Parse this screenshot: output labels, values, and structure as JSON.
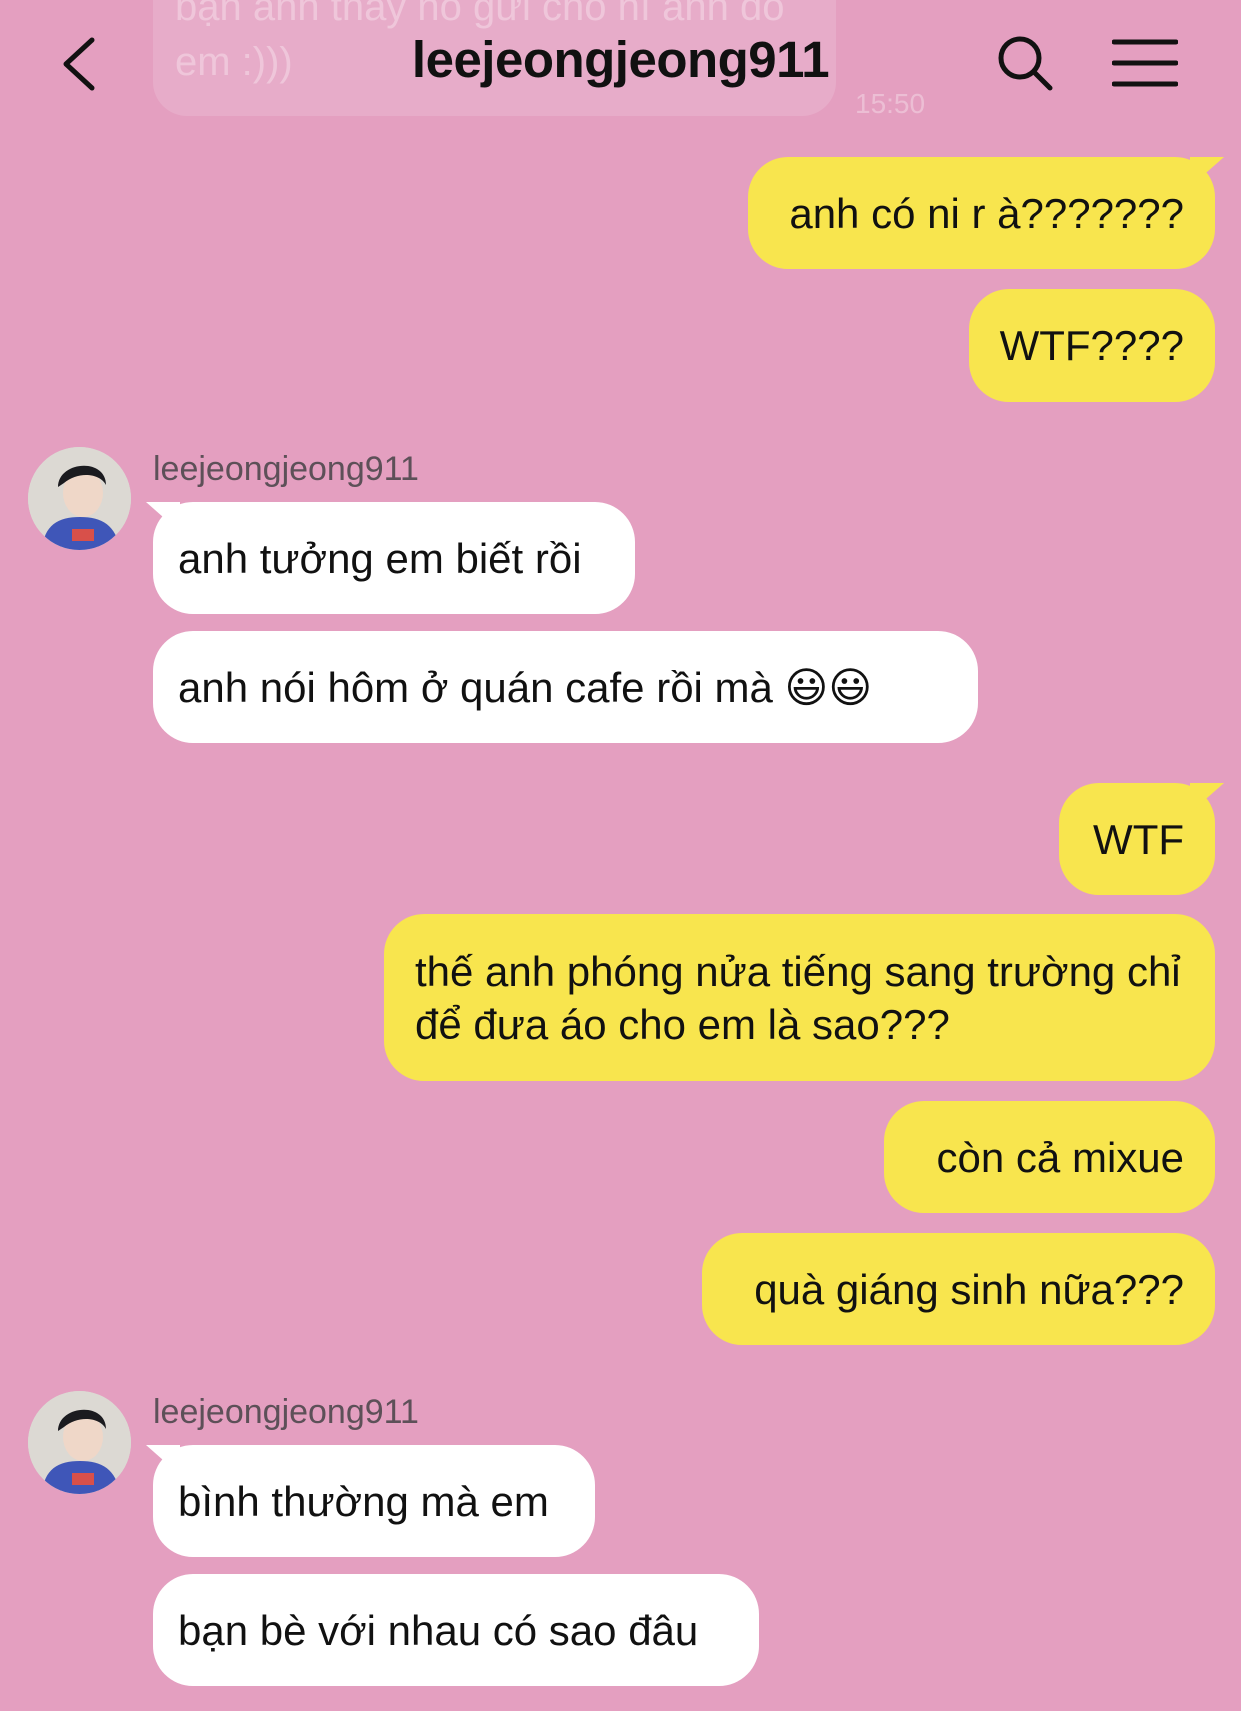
{
  "header": {
    "title": "leejeongjeong911"
  },
  "faded_top": {
    "text": "bạn anh thấy nó gửi cho ní anh đó em :)))",
    "time": "15:50"
  },
  "colors": {
    "background": "#e49fc0",
    "outgoing_bubble": "#f8e54e",
    "incoming_bubble": "#ffffff"
  },
  "icons": {
    "back": "chevron-left-icon",
    "search": "search-icon",
    "menu": "hamburger-menu-icon"
  },
  "messages": [
    {
      "direction": "out",
      "text": "anh có ni r à???????"
    },
    {
      "direction": "out",
      "text": "WTF????"
    },
    {
      "direction": "in",
      "sender": "leejeongjeong911",
      "text": "anh tưởng em biết rồi"
    },
    {
      "direction": "in",
      "text": "anh nói hôm ở quán cafe rồi mà 😃😃"
    },
    {
      "direction": "out",
      "text": "WTF"
    },
    {
      "direction": "out",
      "text": "thế anh phóng nửa tiếng sang trường chỉ để đưa áo cho em là sao???"
    },
    {
      "direction": "out",
      "text": "còn cả mixue"
    },
    {
      "direction": "out",
      "text": "quà giáng sinh nữa???"
    },
    {
      "direction": "in",
      "sender": "leejeongjeong911",
      "text": "bình thường mà em"
    },
    {
      "direction": "in",
      "text": "bạn bè với nhau có sao đâu"
    }
  ]
}
